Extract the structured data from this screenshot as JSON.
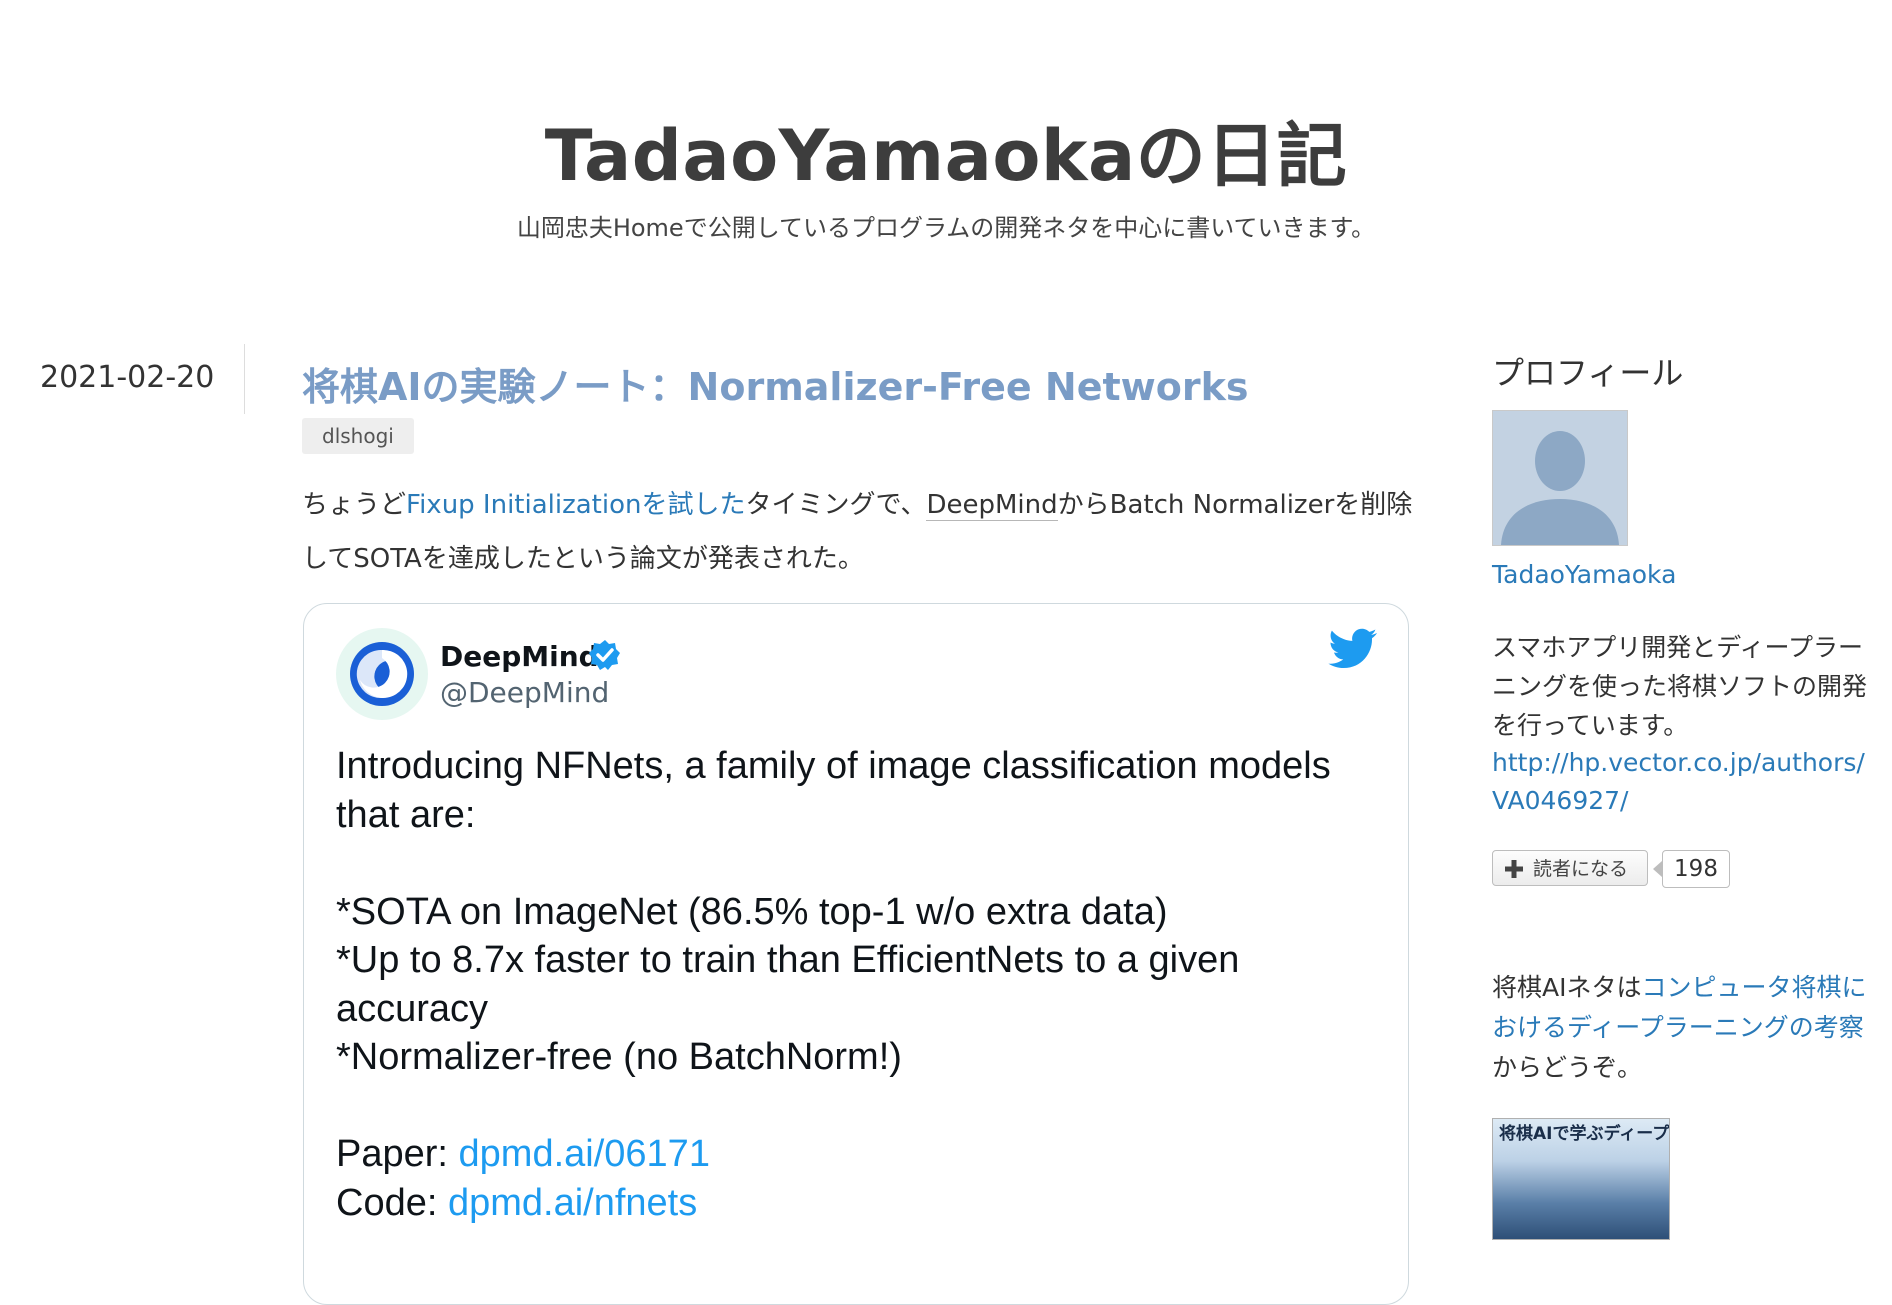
{
  "header": {
    "title": "TadaoYamaokaの日記",
    "description": "山岡忠夫Homeで公開しているプログラムの開発ネタを中心に書いていきます。"
  },
  "entry": {
    "date": "2021-02-20",
    "title": "将棋AIの実験ノート：Normalizer-Free Networks",
    "category": "dlshogi",
    "body": {
      "part1": "ちょうど",
      "link1": "Fixup Initializationを試した",
      "part2": "タイミングで、",
      "keyword": "DeepMind",
      "part3": "からBatch Normalizerを削除してSOTAを達成したという論文が発表された。"
    }
  },
  "tweet": {
    "name": "DeepMind",
    "handle": "@DeepMind",
    "text": "Introducing NFNets, a family of image classification models that are:\n\n*SOTA on ImageNet (86.5% top-1 w/o extra data)\n*Up to 8.7x faster to train than EfficientNets to a given accuracy\n*Normalizer-free (no BatchNorm!)\n\n",
    "paper_label": "Paper: ",
    "paper_link": "dpmd.ai/06171",
    "code_label": "Code: ",
    "code_link": "dpmd.ai/nfnets",
    "icons": {
      "verified": "verified-badge-icon",
      "bird": "twitter-bird-icon"
    },
    "colors": {
      "link": "#1d9bf0",
      "verified": "#1d9bf0",
      "avatar_logo": "#1a5fd6"
    }
  },
  "sidebar": {
    "profile_heading": "プロフィール",
    "profile_name": "TadaoYamaoka",
    "profile_desc": "スマホアプリ開発とディープラーニングを使った将棋ソフトの開発を行っています。",
    "profile_url": "http://hp.vector.co.jp/authors/VA046927/",
    "subscribe_label": "読者になる",
    "reader_count": "198",
    "note": {
      "part1": "将棋AIネタは",
      "link": "コンピュータ将棋におけるディープラーニングの考察",
      "part2": "からどうぞ。"
    },
    "book_title": "将棋AIで学ぶディープラーニング"
  },
  "colors": {
    "title_link": "#7a9cc6",
    "body_link": "#2a7ab8",
    "text": "#333333"
  }
}
